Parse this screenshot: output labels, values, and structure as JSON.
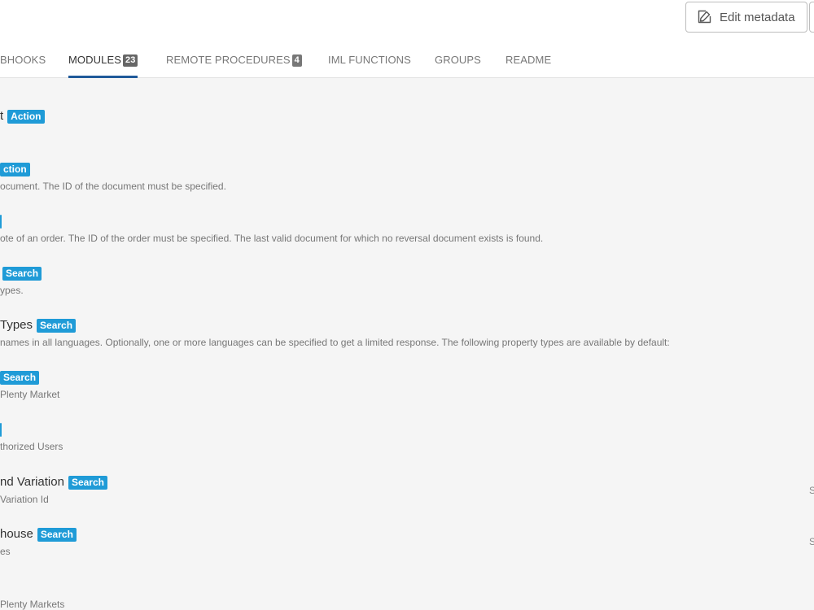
{
  "header": {
    "edit_button_label": "Edit metadata",
    "edit_icon": "edit-icon"
  },
  "tabs": [
    {
      "label": "BHOOKS",
      "count": null,
      "active": false
    },
    {
      "label": "MODULES",
      "count": "23",
      "active": true
    },
    {
      "label": "REMOTE PROCEDURES",
      "count": "4",
      "active": false
    },
    {
      "label": "IML FUNCTIONS",
      "count": null,
      "active": false
    },
    {
      "label": "GROUPS",
      "count": null,
      "active": false
    },
    {
      "label": "README",
      "count": null,
      "active": false
    }
  ],
  "modules": [
    {
      "title": "t",
      "badge": "Action",
      "description": ""
    },
    {
      "title": "",
      "badge": "ction",
      "description": "ocument. The ID of the document must be specified."
    },
    {
      "title": "",
      "badge": "",
      "description": "ote of an order. The ID of the order must be specified. The last valid document for which no reversal document exists is found."
    },
    {
      "title": "",
      "badge": "Search",
      "description": "ypes."
    },
    {
      "title": "Types",
      "badge": "Search",
      "description": "names in all languages. Optionally, one or more languages can be specified to get a limited response. The following property types are available by default:"
    },
    {
      "title": "",
      "badge": "Search",
      "description": "Plenty Market"
    },
    {
      "title": "",
      "badge": "",
      "description": "thorized Users"
    },
    {
      "title": "nd Variation",
      "badge": "Search",
      "description": "Variation Id"
    },
    {
      "title": "house",
      "badge": "Search",
      "description": "es"
    },
    {
      "title": "",
      "badge": "",
      "description": "Plenty Markets"
    }
  ],
  "right_edge": [
    "S",
    "S"
  ],
  "colors": {
    "badge": "#1f9bd7",
    "active_tab_underline": "#1f5a9a"
  }
}
